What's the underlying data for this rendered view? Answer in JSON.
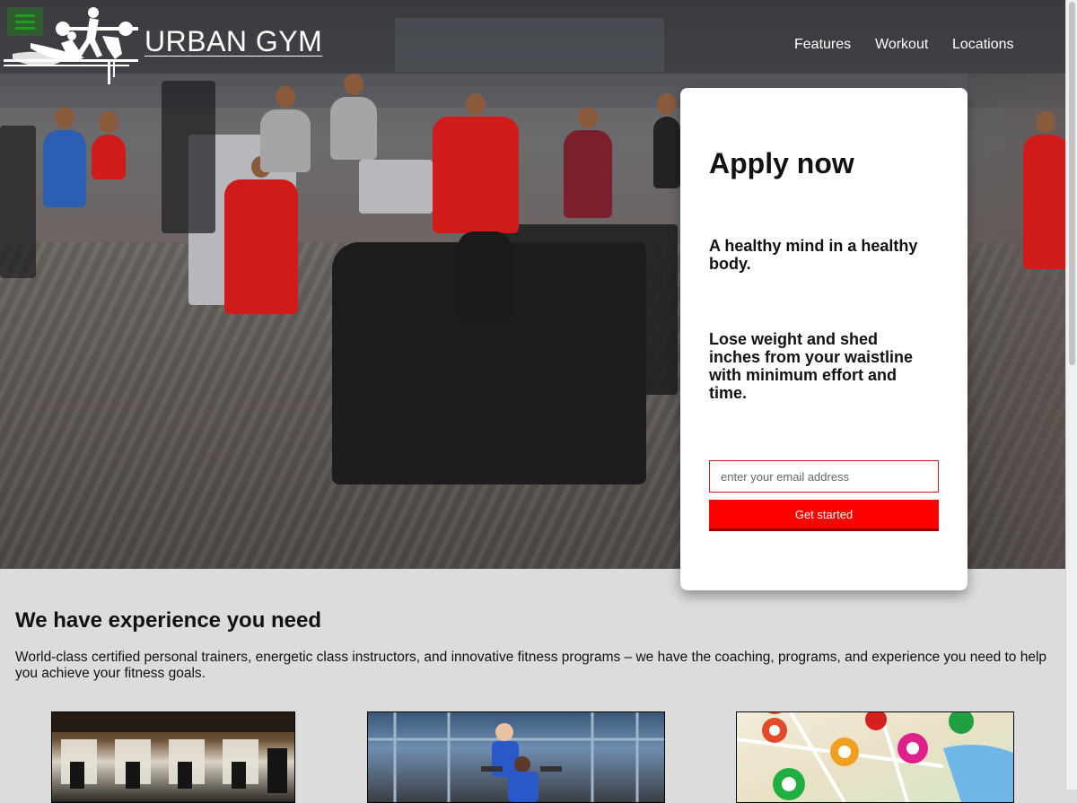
{
  "header": {
    "brand": "URBAN GYM",
    "nav": [
      {
        "label": "Features"
      },
      {
        "label": "Workout"
      },
      {
        "label": "Locations"
      }
    ]
  },
  "apply_card": {
    "title": "Apply now",
    "tagline": "A healthy mind in a healthy body.",
    "description": "Lose weight and shed inches from your waistline with minimum effort and time.",
    "email_placeholder": "enter your email address",
    "cta_label": "Get started"
  },
  "experience": {
    "title": "We have experience you need",
    "text": "World-class certified personal trainers, energetic class instructors, and innovative fitness programs – we have the coaching, programs, and experience you need to help you achieve your fitness goals."
  },
  "colors": {
    "accent": "#ff0000",
    "menu_button": "#2f5d2f"
  },
  "icons": {
    "menu": "hamburger-icon",
    "logo": "athletes-logo"
  }
}
